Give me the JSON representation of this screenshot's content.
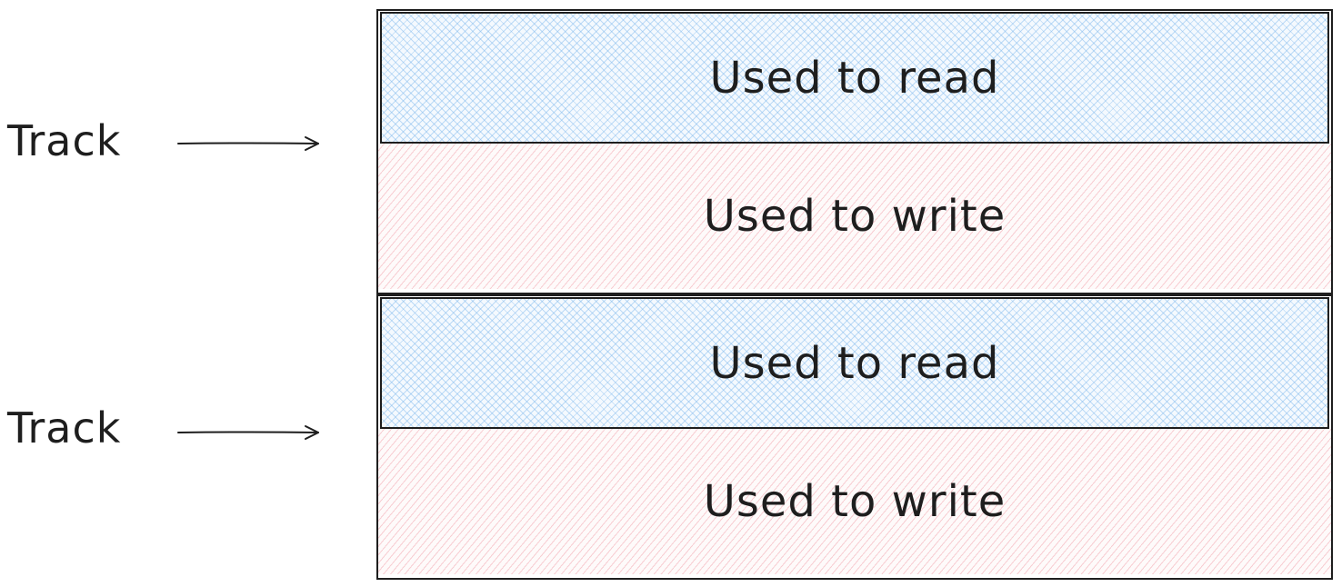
{
  "tracks": [
    {
      "label": "Track",
      "read_label": "Used to read",
      "write_label": "Used to write"
    },
    {
      "label": "Track",
      "read_label": "Used to read",
      "write_label": "Used to write"
    }
  ],
  "colors": {
    "stroke": "#1e1e1e",
    "read_fill": "#a5d8ff",
    "write_fill": "#ffc9c9"
  }
}
